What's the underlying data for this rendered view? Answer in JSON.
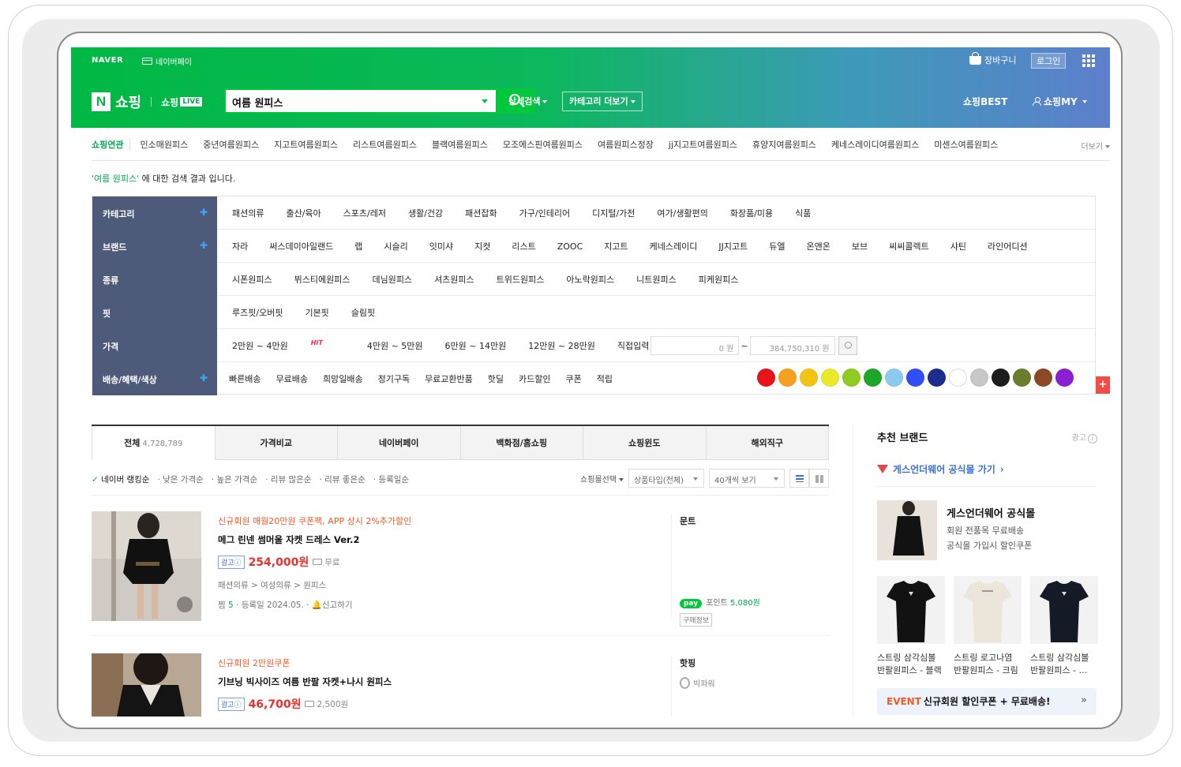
{
  "header": {
    "naver": "NAVER",
    "npay": "네이버페이",
    "cart": "장바구니",
    "login": "로그인",
    "shop": "쇼핑",
    "shop_live": "쇼핑",
    "live_badge": "LIVE",
    "search_query": "여름 원피스",
    "detail_search": "상세검색",
    "category_more": "카테고리 더보기",
    "shopping_best": "쇼핑BEST",
    "shopping_my": "쇼핑MY"
  },
  "related": {
    "label": "쇼핑연관",
    "items": [
      "민소매원피스",
      "중년여름원피스",
      "지고트여름원피스",
      "리스트여름원피스",
      "블랙여름원피스",
      "모조에스핀여름원피스",
      "여름원피스정장",
      "jj지고트여름원피스",
      "휴양지여름원피스",
      "케네스레이디여름원피스",
      "미센스여름원피스"
    ],
    "more": "더보기"
  },
  "result_msg": {
    "query": "'여름 원피스'",
    "suffix": " 에 대한 검색 결과 입니다."
  },
  "filters": {
    "category": {
      "label": "카테고리",
      "values": [
        "패션의류",
        "출산/육아",
        "스포츠/레저",
        "생활/건강",
        "패션잡화",
        "가구/인테리어",
        "디지털/가전",
        "여가/생활편의",
        "화장품/미용",
        "식품"
      ]
    },
    "brand": {
      "label": "브랜드",
      "values": [
        "자라",
        "써스데이아일랜드",
        "랩",
        "시슬리",
        "잇미샤",
        "지컷",
        "리스트",
        "ZOOC",
        "지고트",
        "케네스레이디",
        "JJ지고트",
        "듀엘",
        "온앤온",
        "보브",
        "씨씨콜렉트",
        "샤틴",
        "라인어디션"
      ]
    },
    "type": {
      "label": "종류",
      "values": [
        "시폰원피스",
        "뷔스티에원피스",
        "데님원피스",
        "셔츠원피스",
        "트위드원피스",
        "아노락원피스",
        "니트원피스",
        "피케원피스"
      ]
    },
    "fit": {
      "label": "핏",
      "values": [
        "루즈핏/오버핏",
        "기본핏",
        "슬림핏"
      ]
    },
    "price": {
      "label": "가격",
      "ranges": [
        "2만원 ~ 4만원",
        "4만원 ~ 5만원",
        "6만원 ~ 14만원",
        "12만원 ~ 28만원"
      ],
      "hit": "HIT",
      "direct": "직접입력",
      "min": "0 원",
      "max": "384,750,310 원",
      "tilde": "~"
    },
    "delivery": {
      "label": "배송/혜택/색상",
      "values": [
        "빠른배송",
        "무료배송",
        "희망일배송",
        "정기구독",
        "무료교환반품",
        "핫딜",
        "카드할인",
        "쿠폰",
        "적립"
      ]
    },
    "colors": [
      "#e8141c",
      "#f5a01e",
      "#f4c415",
      "#eae929",
      "#8fcc1f",
      "#1ea629",
      "#8ccbf0",
      "#2d4ff5",
      "#1c2d8c",
      "#ffffff",
      "#c7c7c7",
      "#1c1c1c",
      "#6b7d2c",
      "#8a4a25",
      "#8b1fd1"
    ]
  },
  "tabs": [
    {
      "label": "전체",
      "count": "4,728,789"
    },
    {
      "label": "가격비교"
    },
    {
      "label": "네이버페이"
    },
    {
      "label": "백화점/홈쇼핑"
    },
    {
      "label": "쇼핑윈도"
    },
    {
      "label": "해외직구"
    }
  ],
  "sort": {
    "options": [
      "네이버 랭킹순",
      "낮은 가격순",
      "높은 가격순",
      "리뷰 많은순",
      "리뷰 좋은순",
      "등록일순"
    ],
    "mall_select": "쇼핑몰선택",
    "product_type": "상품타입(전체)",
    "per_page": "40개씩 보기"
  },
  "products": [
    {
      "promo": "신규회원 매월20만원 쿠폰팩, APP 상시 2%추가할인",
      "title": "메그 린넨 썸머울 자켓 드레스 Ver.2",
      "ad": "광고ⓘ",
      "price": "254,000원",
      "shipping": "무료",
      "category": "패션의류 > 여성의류 > 원피스",
      "zzim": "찜",
      "zzim_count": "5",
      "registered": "등록일 2024.05.",
      "report": "신고하기",
      "mall": "문트",
      "npay": "pay",
      "point_label": "포인트",
      "point": "5,080원",
      "buyinfo": "구매정보"
    },
    {
      "promo": "신규회원 2만원쿠폰",
      "title": "기브닝 빅사이즈 여름 반팔 자켓+나시 원피스",
      "ad": "광고ⓘ",
      "price": "46,700원",
      "shipping": "2,500원",
      "mall": "핫핑",
      "grade": "빅파워"
    }
  ],
  "sidebar": {
    "title": "추천 브랜드",
    "ad": "광고",
    "guess_link": "게스언더웨어 공식몰 가기",
    "featured_name": "게스언더웨어 공식몰",
    "featured_line1": "회원 전품목 무료배송",
    "featured_line2": "공식몰 가입시 할인쿠폰",
    "thumbs": [
      "스트링 삼각심볼 반팔원피스 - 블랙",
      "스트링 로고나염 반팔원피스 - 크림",
      "스트링 삼각심볼 반팔원피스 - …"
    ],
    "event_tag": "EVENT",
    "event_text": "신규회원 할인쿠폰 + 무료배송!"
  }
}
